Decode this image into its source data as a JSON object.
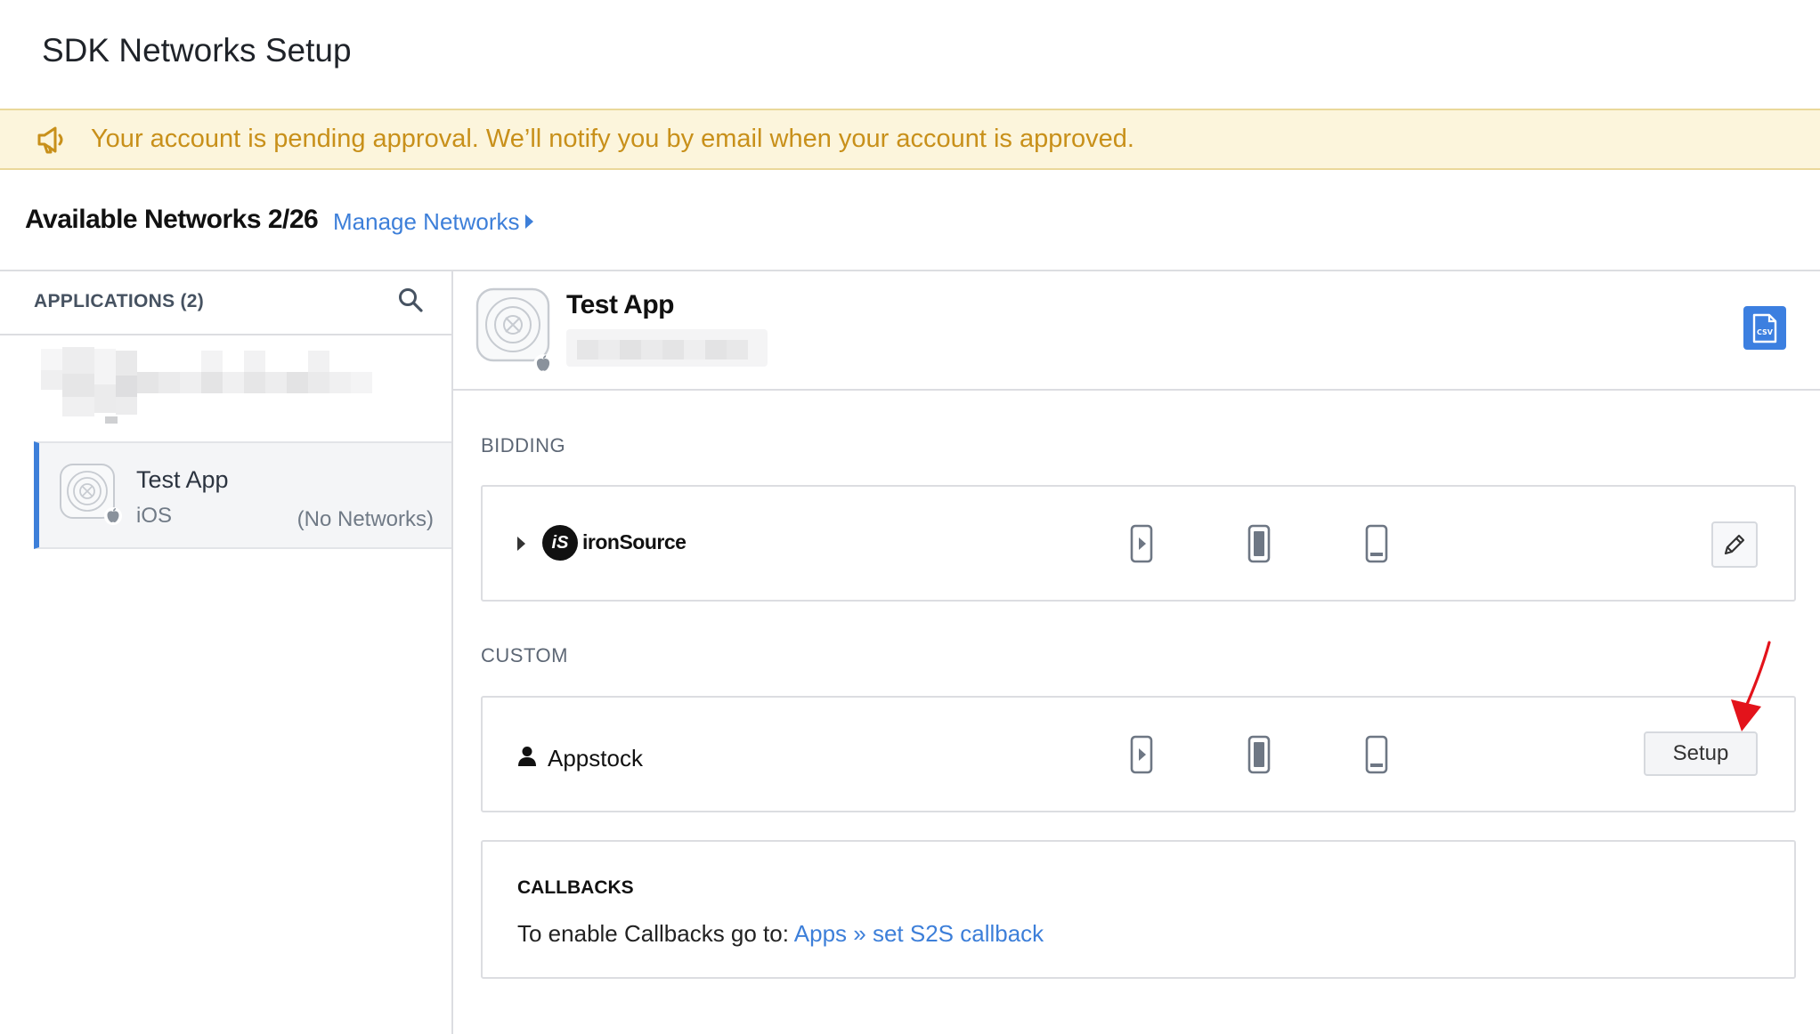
{
  "page": {
    "title": "SDK Networks Setup"
  },
  "banner": {
    "icon": "megaphone-icon",
    "message": "Your account is pending approval. We’ll notify you by email when your account is approved."
  },
  "networks": {
    "available_label": "Available Networks 2/26",
    "manage_link": "Manage Networks"
  },
  "sidebar": {
    "header": "APPLICATIONS (2)",
    "apps": [
      {
        "name": "Test App",
        "platform": "iOS",
        "status": "(No Networks)",
        "selected": true
      }
    ]
  },
  "detail": {
    "app_name": "Test App",
    "csv_label": "CSV",
    "bidding": {
      "label": "BIDDING",
      "network": {
        "name": "ironSource",
        "logo_text": "iS"
      }
    },
    "custom": {
      "label": "CUSTOM",
      "network": {
        "name": "Appstock",
        "action": "Setup"
      }
    },
    "callbacks": {
      "title": "CALLBACKS",
      "text": "To enable Callbacks go to: ",
      "link_apps": "Apps",
      "separator": " » ",
      "link_s2s": "set S2S callback"
    }
  },
  "colors": {
    "accent": "#3d7fd9",
    "banner_bg": "#fcf5dc",
    "banner_text": "#c8901a",
    "annotation_arrow": "#e3131b"
  }
}
